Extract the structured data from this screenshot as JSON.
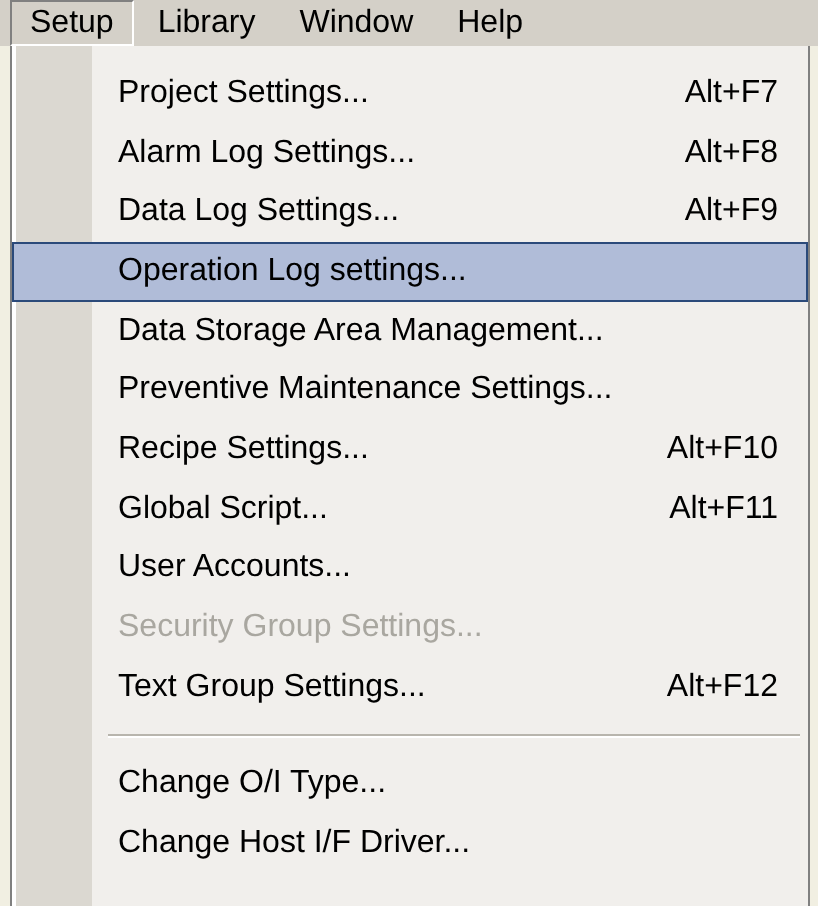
{
  "menu_bar": [
    {
      "label": "Setup",
      "selected": true
    },
    {
      "label": "Library",
      "selected": false
    },
    {
      "label": "Window",
      "selected": false
    },
    {
      "label": "Help",
      "selected": false
    }
  ],
  "menu": {
    "items": [
      {
        "kind": "item",
        "label": "Project Settings...",
        "shortcut": "Alt+F7",
        "selected": false,
        "disabled": false
      },
      {
        "kind": "item",
        "label": "Alarm Log Settings...",
        "shortcut": "Alt+F8",
        "selected": false,
        "disabled": false
      },
      {
        "kind": "item",
        "label": "Data Log Settings...",
        "shortcut": "Alt+F9",
        "selected": false,
        "disabled": false
      },
      {
        "kind": "item",
        "label": "Operation Log settings...",
        "selected": true,
        "disabled": false
      },
      {
        "kind": "item",
        "label": "Data Storage Area Management...",
        "selected": false,
        "disabled": false
      },
      {
        "kind": "item",
        "label": "Preventive Maintenance Settings...",
        "selected": false,
        "disabled": false
      },
      {
        "kind": "item",
        "label": "Recipe Settings...",
        "shortcut": "Alt+F10",
        "selected": false,
        "disabled": false
      },
      {
        "kind": "item",
        "label": "Global Script...",
        "shortcut": "Alt+F11",
        "selected": false,
        "disabled": false
      },
      {
        "kind": "item",
        "label": "User Accounts...",
        "selected": false,
        "disabled": false
      },
      {
        "kind": "item",
        "label": "Security Group Settings...",
        "selected": false,
        "disabled": true
      },
      {
        "kind": "item",
        "label": "Text Group Settings...",
        "shortcut": "Alt+F12",
        "selected": false,
        "disabled": false
      },
      {
        "kind": "separator"
      },
      {
        "kind": "item",
        "label": "Change O/I Type...",
        "selected": false,
        "disabled": false
      },
      {
        "kind": "item",
        "label": "Change Host I/F Driver...",
        "selected": false,
        "disabled": false
      }
    ]
  }
}
